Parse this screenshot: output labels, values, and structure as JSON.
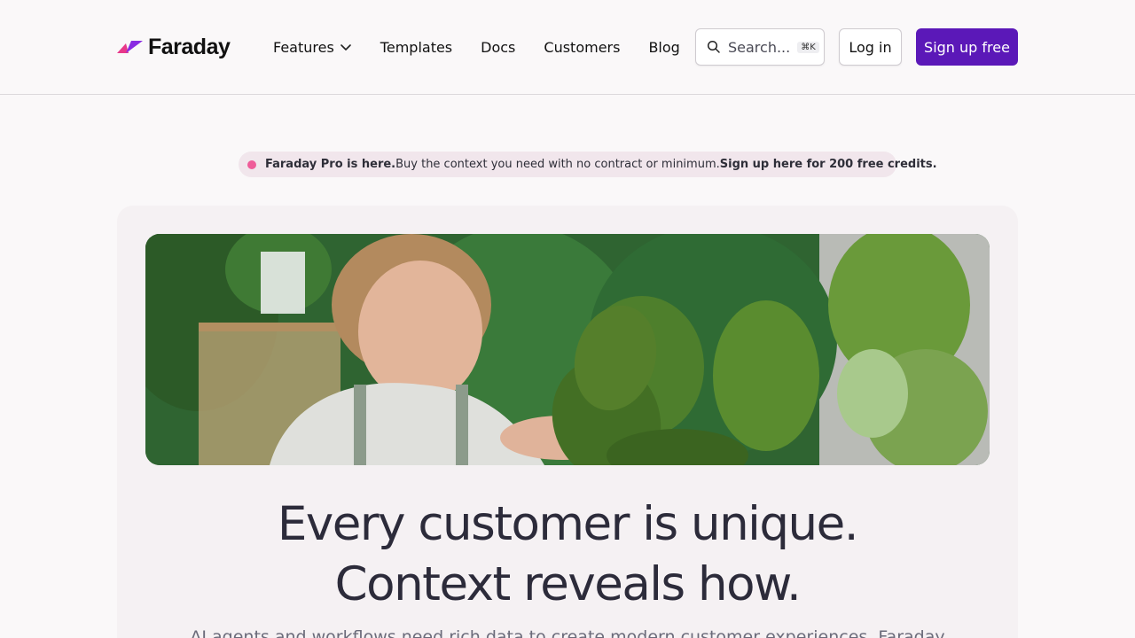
{
  "header": {
    "brand": "Faraday",
    "nav": [
      {
        "label": "Features"
      },
      {
        "label": "Templates"
      },
      {
        "label": "Docs"
      },
      {
        "label": "Customers"
      },
      {
        "label": "Blog"
      }
    ],
    "search": {
      "placeholder": "Search...",
      "shortcut": "⌘K"
    },
    "login_label": "Log in",
    "signup_label": "Sign up free"
  },
  "banner": {
    "lead": "Faraday Pro is here.",
    "body": "Buy the context you need with no contract or minimum.",
    "cta": "Sign up here for 200 free credits."
  },
  "hero": {
    "title_line1": "Every customer is unique.",
    "title_line2": "Context reveals how.",
    "subtitle": "AI agents and workflows need rich data to create modern customer experiences. Faraday"
  },
  "colors": {
    "accent": "#5b18b8",
    "banner_dot": "#ef5c99",
    "logo_pink": "#e8388a",
    "logo_purple": "#8a2be2"
  },
  "icons": {
    "logo": "faraday-logo-mark",
    "features_dropdown": "chevron-down-icon",
    "search": "search-icon"
  }
}
